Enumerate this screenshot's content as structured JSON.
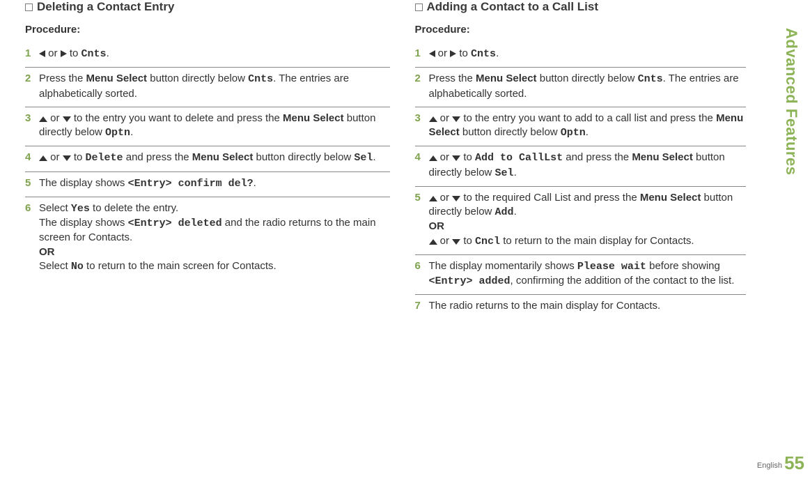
{
  "sidebar": "Advanced Features",
  "pagenum": "55",
  "language": "English",
  "left": {
    "title": "Deleting a Contact Entry",
    "procedure": "Procedure:",
    "steps": {
      "s1": {
        "a": " or ",
        "b": " to ",
        "cnts": "Cnts",
        "end": "."
      },
      "s2": {
        "a": "Press the ",
        "ms": "Menu Select",
        "b": " button directly below ",
        "cnts": "Cnts",
        "c": ". The entries are alphabetically sorted."
      },
      "s3": {
        "a": " or ",
        "b": " to the entry you want to delete and press the ",
        "ms": "Menu Select",
        "c": " button directly below ",
        "optn": "Optn",
        "end": "."
      },
      "s4": {
        "a": " or ",
        "b": " to ",
        "del": "Delete",
        "c": " and press the ",
        "ms": "Menu Select",
        "d": " button directly below ",
        "sel": "Sel",
        "end": "."
      },
      "s5": {
        "a": "The display shows ",
        "msg": "<Entry> confirm del?",
        "end": "."
      },
      "s6": {
        "a": "Select ",
        "yes": "Yes",
        "b": " to delete the entry.",
        "c": "The display shows ",
        "del": "<Entry> deleted",
        "d": " and the radio returns to the main screen for Contacts.",
        "or": "OR",
        "e": "Select ",
        "no": "No",
        "f": " to return to the main screen for Contacts."
      }
    }
  },
  "right": {
    "title": "Adding a Contact to a Call List",
    "procedure": "Procedure:",
    "steps": {
      "s1": {
        "a": " or ",
        "b": " to ",
        "cnts": "Cnts",
        "end": "."
      },
      "s2": {
        "a": "Press the ",
        "ms": "Menu Select",
        "b": " button directly below ",
        "cnts": "Cnts",
        "c": ". The entries are alphabetically sorted."
      },
      "s3": {
        "a": " or ",
        "b": " to the entry you want to add to a call list and press the ",
        "ms": "Menu Select",
        "c": " button directly below ",
        "optn": "Optn",
        "end": "."
      },
      "s4": {
        "a": " or ",
        "b": " to ",
        "add": "Add to CallLst",
        "c": " and press the ",
        "ms": "Menu Select",
        "d": " button directly below ",
        "sel": "Sel",
        "end": "."
      },
      "s5": {
        "a": " or ",
        "b": " to the required Call List and press the ",
        "ms": "Menu Select",
        "c": " button directly below ",
        "addb": "Add",
        "end": ".",
        "or": "OR",
        "d": " or ",
        "e": " to ",
        "cncl": "Cncl",
        "f": " to return to the main display for Contacts."
      },
      "s6": {
        "a": "The display momentarily shows ",
        "pw": "Please wait",
        "b": " before showing ",
        "added": "<Entry> added",
        "c": ", confirming the addition of the contact to the list."
      },
      "s7": {
        "a": "The radio returns to the main display for Contacts."
      }
    }
  }
}
